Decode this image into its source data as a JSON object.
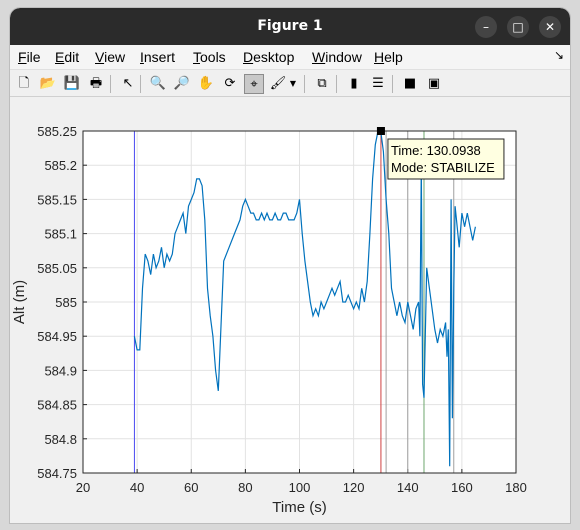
{
  "window": {
    "title": "Figure 1"
  },
  "menu": [
    "File",
    "Edit",
    "View",
    "Insert",
    "Tools",
    "Desktop",
    "Window",
    "Help"
  ],
  "menu_mnemonics": [
    "F",
    "E",
    "V",
    "I",
    "T",
    "D",
    "W",
    "H"
  ],
  "toolbar": [
    {
      "name": "new-figure-icon",
      "glyph": "🗋"
    },
    {
      "name": "open-file-icon",
      "glyph": "📂"
    },
    {
      "name": "save-icon",
      "glyph": "💾"
    },
    {
      "name": "print-icon",
      "glyph": "🖶"
    },
    {
      "name": "pointer-icon",
      "glyph": "↖"
    },
    {
      "name": "zoom-in-icon",
      "glyph": "🔍"
    },
    {
      "name": "zoom-out-icon",
      "glyph": "🔎"
    },
    {
      "name": "pan-hand-icon",
      "glyph": "✋"
    },
    {
      "name": "rotate-3d-icon",
      "glyph": "⟳"
    },
    {
      "name": "data-cursor-icon",
      "glyph": "⌖"
    },
    {
      "name": "brush-icon",
      "glyph": "🖌"
    },
    {
      "name": "link-plot-icon",
      "glyph": "⧉"
    },
    {
      "name": "colorbar-icon",
      "glyph": "▮"
    },
    {
      "name": "legend-icon",
      "glyph": "☰"
    },
    {
      "name": "hide-plot-tools-icon",
      "glyph": "■"
    },
    {
      "name": "show-plot-tools-icon",
      "glyph": "▣"
    }
  ],
  "datatip": {
    "line1": "Time: 130.0938",
    "line2": "Mode: STABILIZE",
    "x": 130.0938,
    "y": 585.25
  },
  "chart_data": {
    "type": "line",
    "xlabel": "Time (s)",
    "ylabel": "Alt (m)",
    "xlim": [
      20,
      180
    ],
    "ylim": [
      584.75,
      585.25
    ],
    "xticks": [
      "20",
      "40",
      "60",
      "80",
      "100",
      "120",
      "140",
      "160",
      "180"
    ],
    "yticks": [
      "585.25",
      "585.2",
      "585.15",
      "585.1",
      "585.05",
      "585",
      "584.95",
      "584.9",
      "584.85",
      "584.8",
      "584.75"
    ],
    "grid": true,
    "color": "#0072bd",
    "vlines": [
      {
        "x": 39,
        "color": "#4a4af0"
      },
      {
        "x": 130.09,
        "color": "#d04040"
      },
      {
        "x": 132,
        "color": "#a0a0a0"
      },
      {
        "x": 140,
        "color": "#a0a0a0"
      },
      {
        "x": 146,
        "color": "#6fa86f"
      },
      {
        "x": 157,
        "color": "#a0a0a0"
      }
    ],
    "x": [
      39,
      40,
      41,
      42,
      43,
      44,
      45,
      46,
      47,
      48,
      49,
      50,
      51,
      52,
      53,
      54,
      55,
      56,
      57,
      58,
      59,
      60,
      61,
      62,
      63,
      64,
      65,
      66,
      67,
      68,
      69,
      70,
      72,
      74,
      76,
      78,
      79,
      80,
      81,
      82,
      83,
      84,
      85,
      86,
      87,
      88,
      89,
      90,
      91,
      92,
      93,
      94,
      95,
      96,
      97,
      98,
      99,
      100,
      101,
      102,
      103,
      104,
      105,
      106,
      107,
      108,
      109,
      110,
      111,
      112,
      113,
      114,
      115,
      116,
      117,
      118,
      119,
      120,
      121,
      122,
      123,
      124,
      125,
      126,
      127,
      128,
      129,
      130,
      131,
      132,
      133,
      134,
      135,
      136,
      137,
      138,
      139,
      140,
      141,
      142,
      143,
      144,
      144.5,
      145,
      145.5,
      146,
      147,
      148,
      149,
      150,
      151,
      152,
      153,
      154,
      154.5,
      155,
      155.5,
      156,
      156.5,
      157,
      157.5,
      158,
      159,
      160,
      161,
      162,
      163,
      164,
      165
    ],
    "y": [
      584.95,
      584.93,
      584.93,
      585.02,
      585.07,
      585.06,
      585.04,
      585.07,
      585.05,
      585.06,
      585.08,
      585.05,
      585.07,
      585.06,
      585.07,
      585.1,
      585.11,
      585.12,
      585.13,
      585.1,
      585.14,
      585.15,
      585.16,
      585.18,
      585.18,
      585.17,
      585.12,
      585.02,
      584.98,
      584.95,
      584.9,
      584.87,
      585.06,
      585.08,
      585.1,
      585.12,
      585.14,
      585.15,
      585.14,
      585.13,
      585.13,
      585.12,
      585.12,
      585.13,
      585.12,
      585.13,
      585.12,
      585.12,
      585.13,
      585.12,
      585.12,
      585.13,
      585.13,
      585.12,
      585.12,
      585.12,
      585.13,
      585.15,
      585.1,
      585.06,
      585.03,
      585.0,
      584.98,
      584.99,
      584.98,
      585.0,
      584.99,
      585.0,
      585.01,
      585.02,
      585.01,
      585.02,
      585.03,
      585.0,
      585.0,
      585.01,
      585.0,
      584.99,
      585.0,
      584.99,
      585.02,
      585.0,
      585.03,
      585.1,
      585.18,
      585.23,
      585.25,
      585.25,
      585.22,
      585.15,
      585.1,
      585.02,
      585.0,
      584.98,
      585.0,
      584.98,
      584.97,
      585.0,
      584.98,
      584.96,
      584.99,
      585.0,
      584.95,
      585.2,
      584.88,
      584.86,
      585.05,
      585.02,
      584.99,
      584.96,
      584.94,
      584.96,
      584.95,
      584.97,
      584.92,
      584.96,
      584.76,
      585.15,
      584.83,
      585.02,
      585.14,
      585.12,
      585.08,
      585.13,
      585.11,
      585.13,
      585.11,
      585.09,
      585.11
    ]
  }
}
